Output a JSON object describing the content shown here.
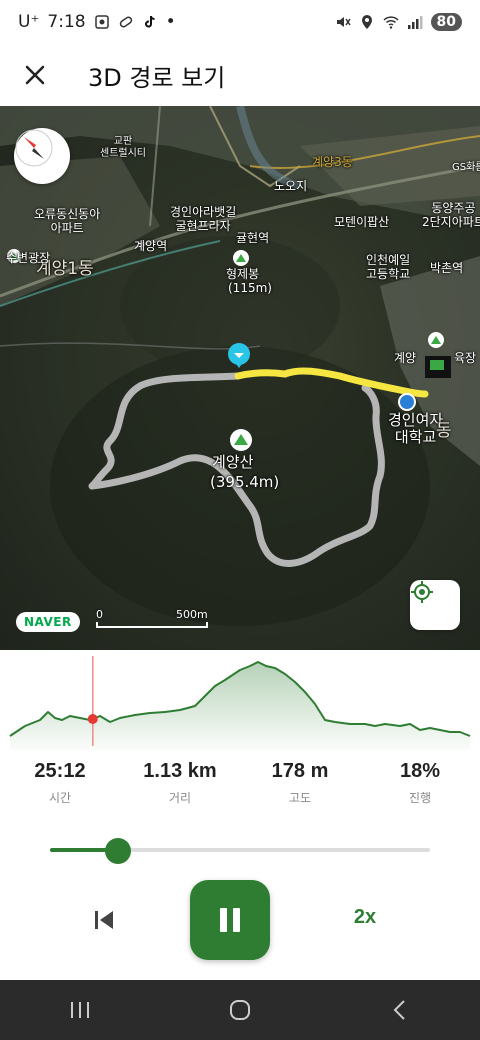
{
  "status_bar": {
    "carrier": "U⁺",
    "time": "7:18",
    "dot": "•",
    "battery": "80"
  },
  "header": {
    "title": "3D 경로 보기"
  },
  "map": {
    "labels": {
      "gyeyang1dong": "계양1동",
      "gyeyangsan_name": "계양산",
      "gyeyangsan_alt": "(395.4m)",
      "hyeongjaebong": "형제봉",
      "hyeongjaebong_alt": "(115m)",
      "gyeongin_univ": "경인여자\n대학교",
      "incheon_school": "인천예일\n고등학교",
      "gyeyang_station": "계양역",
      "gyulhyeon_station": "귤현역",
      "bakchon_station": "박촌역",
      "noji": "노오지",
      "gyeyang3dong": "계양3동",
      "moteuni": "모텐이팝산",
      "donga": "오류동신동아\n아파트",
      "supyeon": "수변광장",
      "gyeongin_ara": "경인아라뱃길\n굴현프라자",
      "dongyang": "동양주공\n2단지아파트",
      "gyeyang_sports": "계양",
      "yukjang": "육장",
      "gyeyang_dong_partial": "동",
      "gs": "GS화름",
      "gyegeo_center": "교판\n센트럴시티"
    },
    "naver_logo": "NAVER",
    "scale_zero": "0",
    "scale_label": "500m"
  },
  "elevation_profile": {
    "progress_fraction": 0.18
  },
  "stats": [
    {
      "value": "25:12",
      "label": "시간"
    },
    {
      "value": "1.13 km",
      "label": "거리"
    },
    {
      "value": "178 m",
      "label": "고도"
    },
    {
      "value": "18%",
      "label": "진행"
    }
  ],
  "playback": {
    "progress_fraction": 0.18,
    "speed_label": "2x"
  },
  "colors": {
    "accent": "#2e7d32",
    "route_done": "#f5e642",
    "route_remaining": "#b5b5b5",
    "marker": "#29c5e6"
  }
}
